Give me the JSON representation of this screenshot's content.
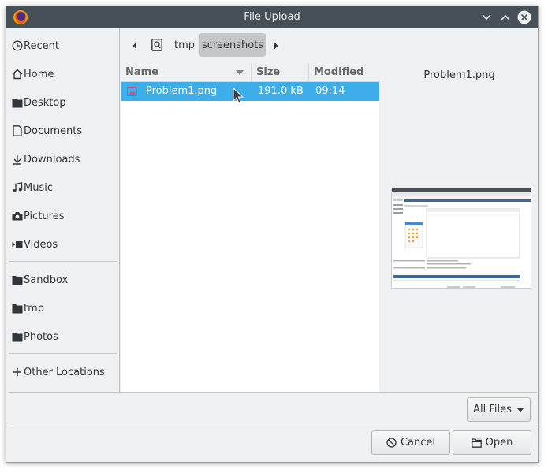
{
  "window": {
    "title": "File Upload",
    "app_icon": "firefox-icon",
    "controls": [
      "minimize-icon",
      "maximize-icon",
      "close-icon"
    ]
  },
  "sidebar": {
    "places": [
      {
        "label": "Recent",
        "icon": "clock-icon"
      },
      {
        "label": "Home",
        "icon": "home-icon"
      },
      {
        "label": "Desktop",
        "icon": "folder-icon"
      },
      {
        "label": "Documents",
        "icon": "document-icon"
      },
      {
        "label": "Downloads",
        "icon": "download-icon"
      },
      {
        "label": "Music",
        "icon": "music-icon"
      },
      {
        "label": "Pictures",
        "icon": "camera-icon"
      },
      {
        "label": "Videos",
        "icon": "video-icon"
      }
    ],
    "bookmarks": [
      {
        "label": "Sandbox",
        "icon": "folder-icon"
      },
      {
        "label": "tmp",
        "icon": "folder-icon"
      },
      {
        "label": "Photos",
        "icon": "folder-icon"
      }
    ],
    "other": {
      "label": "Other Locations",
      "icon": "plus-icon"
    }
  },
  "pathbar": {
    "crumbs": [
      "tmp",
      "screenshots"
    ],
    "active": "screenshots"
  },
  "filelist": {
    "columns": {
      "name": "Name",
      "size": "Size",
      "modified": "Modified"
    },
    "sort": "descending",
    "files": [
      {
        "name": "Problem1.png",
        "size": "191.0 kB",
        "modified": "09:14",
        "selected": true
      }
    ]
  },
  "preview": {
    "filename": "Problem1.png"
  },
  "filter": {
    "label": "All Files"
  },
  "buttons": {
    "cancel": "Cancel",
    "open": "Open"
  },
  "colors": {
    "titlebar": "#475057",
    "selection": "#3daee9",
    "window_bg": "#eff0f1"
  }
}
